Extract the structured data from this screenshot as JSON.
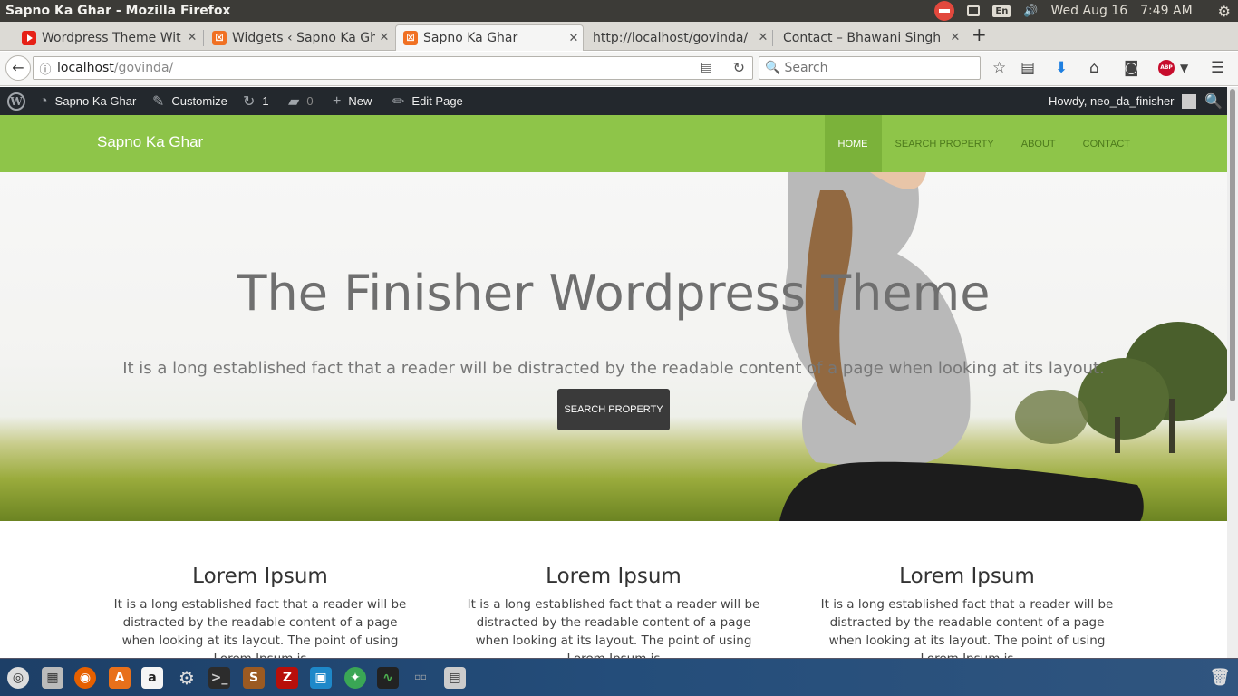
{
  "os": {
    "window_title": "Sapno Ka Ghar - Mozilla Firefox",
    "lang": "En",
    "date": "Wed Aug 16",
    "time": "7:49 AM"
  },
  "tabs": [
    {
      "label": "Wordpress Theme Wit",
      "icon": "youtube-icon"
    },
    {
      "label": "Widgets ‹ Sapno Ka Gh",
      "icon": "xampp-icon"
    },
    {
      "label": "Sapno Ka Ghar",
      "icon": "xampp-icon",
      "active": true
    },
    {
      "label": "http://localhost/govinda/",
      "icon": "none"
    },
    {
      "label": "Contact – Bhawani Singh",
      "icon": "none"
    }
  ],
  "address": {
    "host": "localhost",
    "path": "/govinda/"
  },
  "search": {
    "placeholder": "Search"
  },
  "wp_admin": {
    "site": "Sapno Ka Ghar",
    "customize": "Customize",
    "updates": "1",
    "comments": "0",
    "new": "New",
    "edit": "Edit Page",
    "howdy": "Howdy, neo_da_finisher"
  },
  "site": {
    "title": "Sapno Ka Ghar",
    "menu": [
      "HOME",
      "SEARCH PROPERTY",
      "ABOUT",
      "CONTACT"
    ]
  },
  "hero": {
    "title": "The Finisher Wordpress Theme",
    "subtitle": "It is a long established fact that a reader will be distracted by the readable content of a page when looking at its layout.",
    "button": "SEARCH PROPERTY"
  },
  "features": [
    {
      "title": "Lorem Ipsum",
      "text": "It is a long established fact that a reader will be distracted by the readable content of a page when looking at its layout. The point of using Lorem Ipsum is"
    },
    {
      "title": "Lorem Ipsum",
      "text": "It is a long established fact that a reader will be distracted by the readable content of a page when looking at its layout. The point of using Lorem Ipsum is"
    },
    {
      "title": "Lorem Ipsum",
      "text": "It is a long established fact that a reader will be distracted by the readable content of a page when looking at its layout. The point of using Lorem Ipsum is"
    }
  ],
  "colors": {
    "header_green": "#8ec549",
    "admin_bar": "#23282d",
    "button_dark": "#3a3a3a"
  }
}
